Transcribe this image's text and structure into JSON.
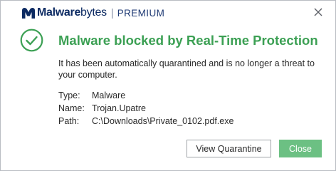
{
  "titlebar": {
    "brand_bold": "Malware",
    "brand_light": "bytes",
    "separator": "|",
    "edition": "PREMIUM",
    "logo_icon": "malwarebytes-logo-icon",
    "close_icon": "close-icon"
  },
  "alert": {
    "status_icon": "check-circle-icon",
    "title": "Malware blocked by Real-Time Protection",
    "description": "It has been automatically quarantined and is no longer a threat to your computer."
  },
  "details": {
    "type_label": "Type:",
    "type_value": "Malware",
    "name_label": "Name:",
    "name_value": "Trojan.Upatre",
    "path_label": "Path:",
    "path_value": "C:\\Downloads\\Private_0102.pdf.exe"
  },
  "buttons": {
    "view_quarantine": "View Quarantine",
    "close": "Close"
  },
  "colors": {
    "brand_navy": "#0c2a62",
    "success_green": "#3ca054",
    "button_green": "#6cc083",
    "text": "#2a2a2a"
  }
}
